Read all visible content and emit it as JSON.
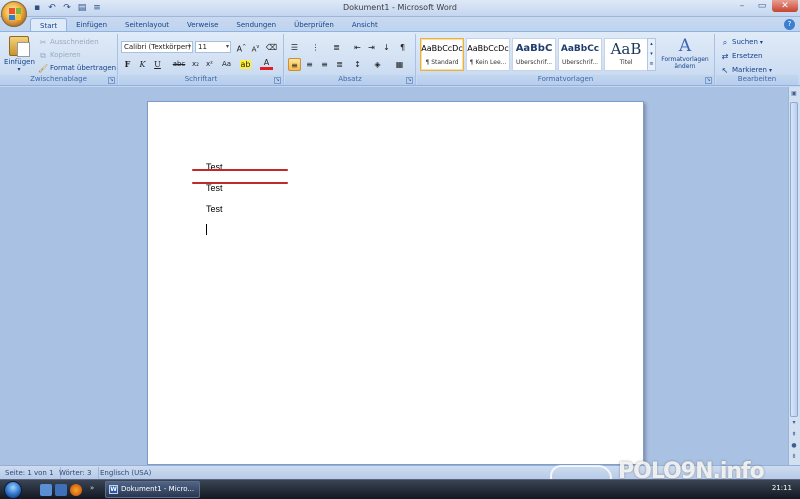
{
  "window": {
    "title": "Dokument1 - Microsoft Word",
    "controls": [
      "minimize",
      "maximize",
      "close"
    ]
  },
  "quick_access": [
    "save-icon",
    "undo-icon",
    "redo-icon",
    "print-preview-icon",
    "customize-icon"
  ],
  "tabs": [
    "Start",
    "Einfügen",
    "Seitenlayout",
    "Verweise",
    "Sendungen",
    "Überprüfen",
    "Ansicht"
  ],
  "active_tab": "Start",
  "clipboard": {
    "paste": "Einfügen",
    "cut": "Ausschneiden",
    "copy": "Kopieren",
    "format_painter": "Format übertragen",
    "group_label": "Zwischenablage"
  },
  "font": {
    "family": "Calibri (Textkörper)",
    "size": "11",
    "group_label": "Schriftart",
    "buttons": {
      "bold": "F",
      "italic": "K",
      "underline": "U",
      "strike": "abc",
      "subscript": "x₂",
      "superscript": "x²",
      "case": "Aa"
    }
  },
  "paragraph": {
    "group_label": "Absatz"
  },
  "styles": {
    "group_label": "Formatvorlagen",
    "items": [
      {
        "sample": "AaBbCcDc",
        "name": "¶ Standard"
      },
      {
        "sample": "AaBbCcDc",
        "name": "¶ Kein Lee..."
      },
      {
        "sample": "AaBbC",
        "name": "Überschrif..."
      },
      {
        "sample": "AaBbCc",
        "name": "Überschrif..."
      },
      {
        "sample": "AaB",
        "name": "Titel"
      }
    ],
    "change_styles": "Formatvorlagen ändern"
  },
  "editing": {
    "group_label": "Bearbeiten",
    "find": "Suchen",
    "replace": "Ersetzen",
    "select": "Markieren"
  },
  "document": {
    "lines": [
      "Test",
      "Test",
      "Test"
    ],
    "annotation_color": "#c0282a"
  },
  "status": {
    "page": "Seite: 1 von 1",
    "words": "Wörter: 3",
    "language": "Englisch (USA)"
  },
  "watermark": "POLO9N.info",
  "taskbar": {
    "task": "Dokument1 - Micro...",
    "clock": "21:11"
  },
  "colors": {
    "ribbon": "#d1e0f3",
    "accent": "#15428b",
    "highlight": "#f8b948",
    "font_color": "#e02020"
  }
}
